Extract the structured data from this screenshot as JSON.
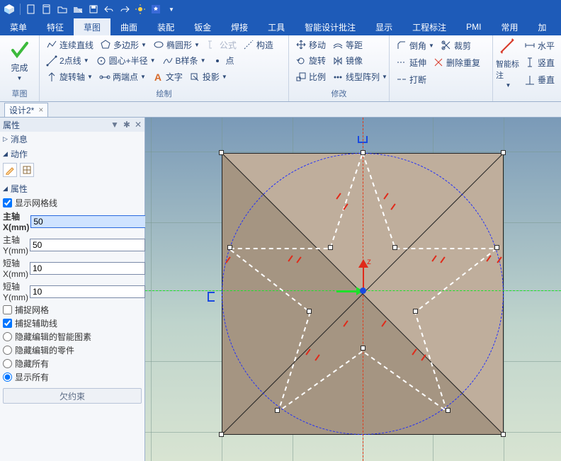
{
  "titlebar": {
    "icons": [
      "app",
      "new",
      "open",
      "folder",
      "recent",
      "save",
      "undo",
      "redo",
      "star",
      "grid"
    ]
  },
  "menubar": {
    "items": [
      "菜单",
      "特征",
      "草图",
      "曲面",
      "装配",
      "钣金",
      "焊接",
      "工具",
      "智能设计批注",
      "显示",
      "工程标注",
      "PMI",
      "常用",
      "加"
    ],
    "active_index": 2
  },
  "ribbon": {
    "g0": {
      "complete": "完成",
      "label": "草图"
    },
    "g1": {
      "r0": {
        "a": "连续直线",
        "b": "多边形",
        "c": "椭圆形",
        "d": "公式",
        "e": "构造"
      },
      "r1": {
        "a": "2点线",
        "b": "圆心+半径",
        "c": "B样条",
        "d": "点"
      },
      "r2": {
        "a": "旋转轴",
        "b": "两端点",
        "c": "文字",
        "d": "投影"
      },
      "label": "绘制"
    },
    "g2": {
      "r0": {
        "a": "移动",
        "b": "等距"
      },
      "r1": {
        "a": "旋转",
        "b": "镜像"
      },
      "r2": {
        "a": "比例",
        "b": "线型阵列"
      },
      "label": "修改"
    },
    "g3": {
      "r0": {
        "a": "倒角",
        "b": "裁剪"
      },
      "r1": {
        "a": "延伸",
        "b": "删除重复"
      },
      "r2": {
        "a": "打断"
      }
    },
    "g4": {
      "big": "智能标注",
      "r0": "水平",
      "r1": "竖直",
      "r2": "垂直"
    }
  },
  "doctab": {
    "name": "设计2*",
    "close": "×"
  },
  "props": {
    "panel_title": "属性",
    "sec_msg": "消息",
    "sec_act": "动作",
    "sec_attr": "属性",
    "show_grid": "显示网格线",
    "major_x": {
      "label": "主轴X(mm)",
      "value": "50"
    },
    "major_y": {
      "label": "主轴Y(mm)",
      "value": "50"
    },
    "minor_x": {
      "label": "短轴X(mm)",
      "value": "10"
    },
    "minor_y": {
      "label": "短轴Y(mm)",
      "value": "10"
    },
    "snap_grid": "捕捉网格",
    "snap_guide": "捕捉辅助线",
    "hide_smart": "隐藏编辑的智能图素",
    "hide_part": "隐藏编辑的零件",
    "hide_all": "隐藏所有",
    "show_all": "显示所有",
    "underc": "欠约束"
  },
  "canvas": {
    "axis_z": "z"
  }
}
